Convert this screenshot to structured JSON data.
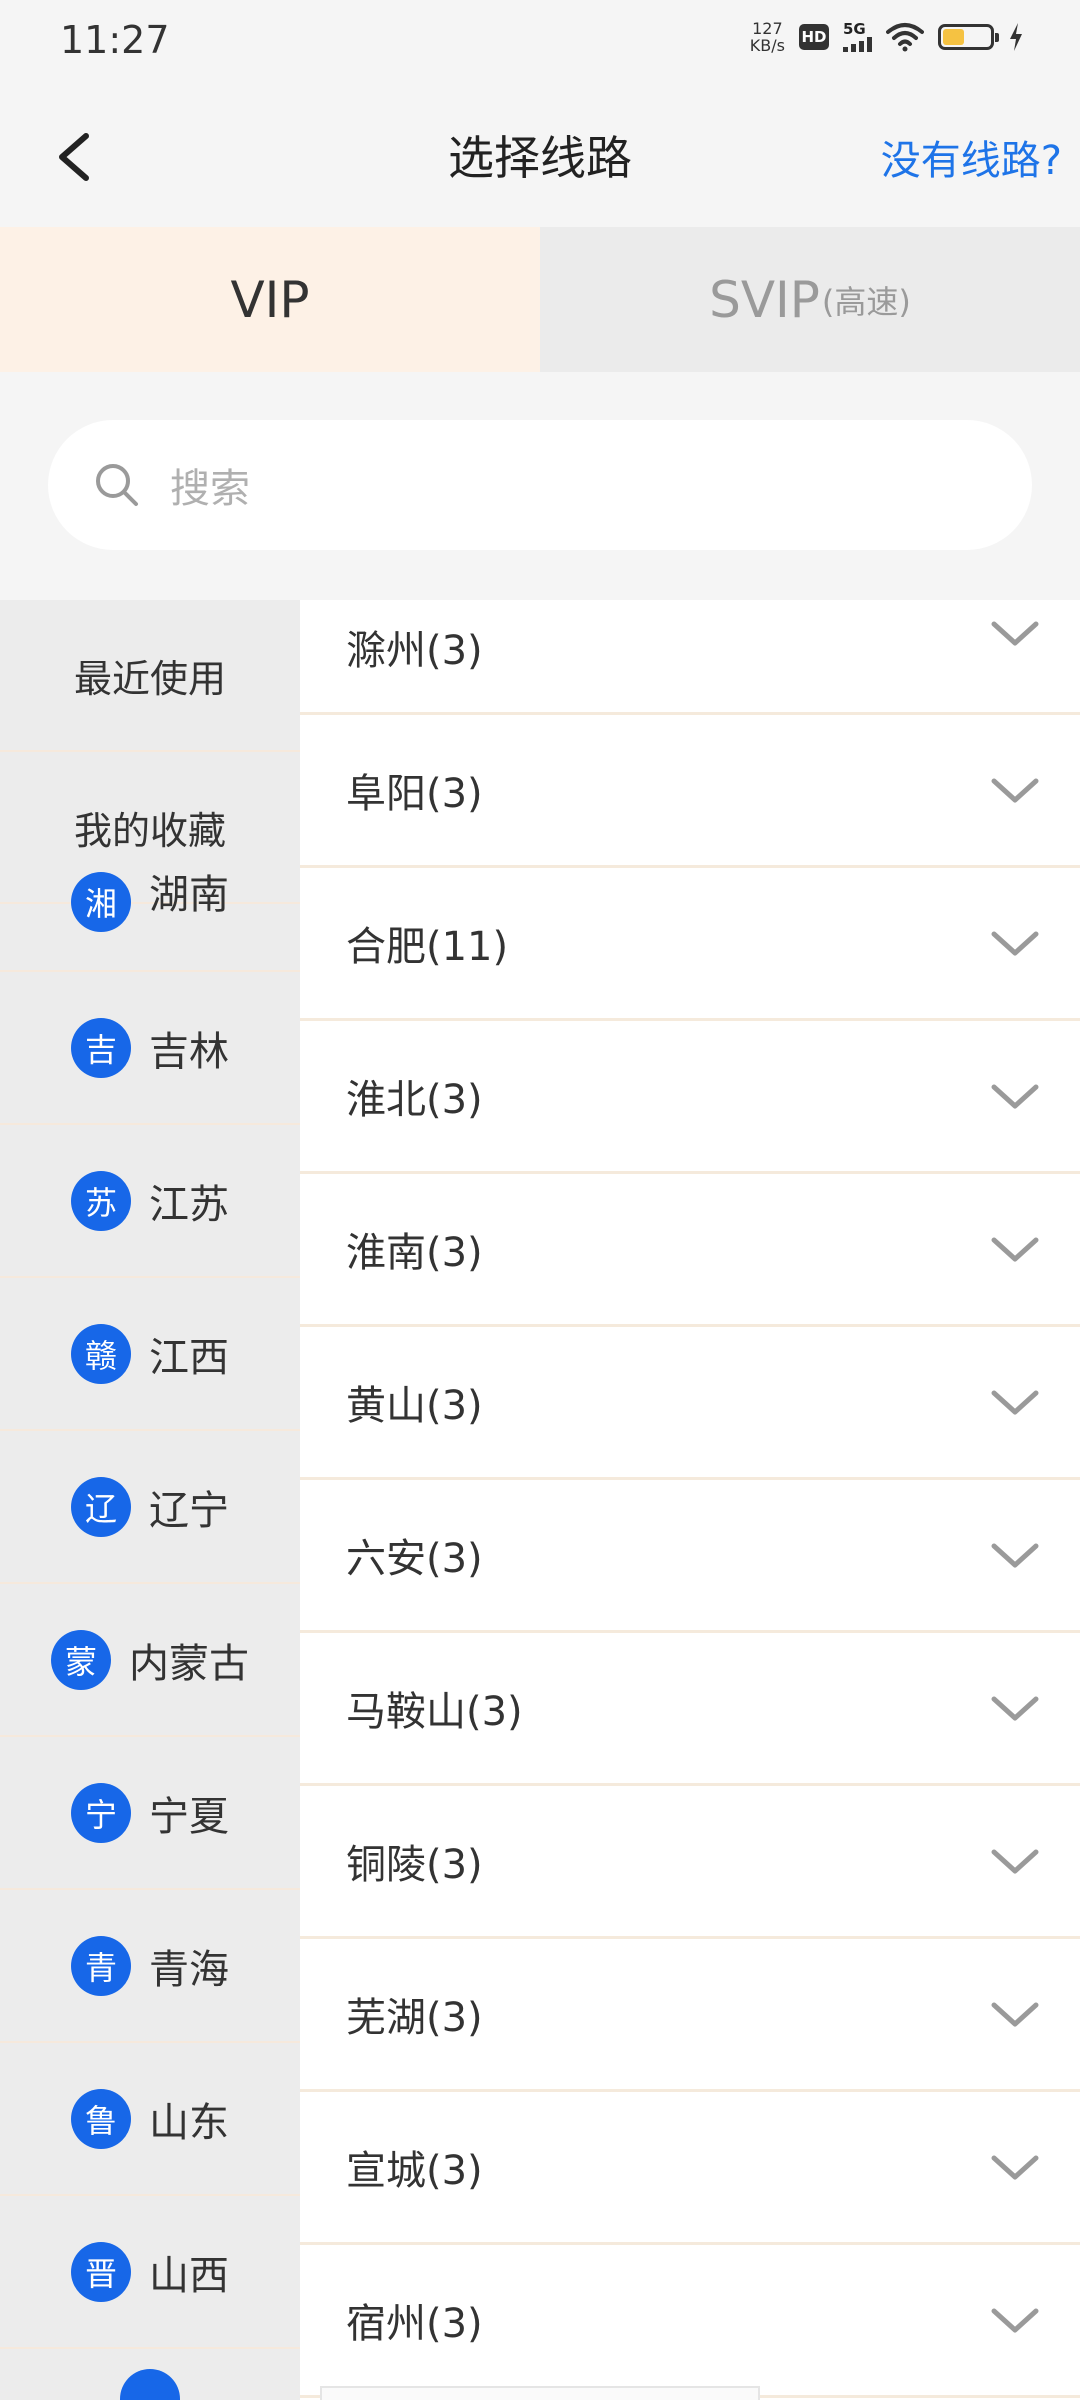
{
  "status_bar": {
    "time": "11:27",
    "net_speed_value": "127",
    "net_speed_unit": "KB/s",
    "hd_label": "HD",
    "network_label": "5G",
    "battery_level_percent": 45,
    "battery_color": "#f5c242"
  },
  "header": {
    "title": "选择线路",
    "no_route_link": "没有线路?",
    "accent_color": "#1e74e8"
  },
  "tabs": [
    {
      "label": "VIP",
      "sub": "",
      "selected": true
    },
    {
      "label": "SVIP",
      "sub": "(高速)",
      "selected": false
    }
  ],
  "search": {
    "placeholder": "搜索"
  },
  "sidebar": {
    "fixed": [
      "最近使用",
      "我的收藏"
    ],
    "provinces": [
      {
        "badge": "湘",
        "name": "湖南"
      },
      {
        "badge": "吉",
        "name": "吉林"
      },
      {
        "badge": "苏",
        "name": "江苏"
      },
      {
        "badge": "赣",
        "name": "江西"
      },
      {
        "badge": "辽",
        "name": "辽宁"
      },
      {
        "badge": "蒙",
        "name": "内蒙古"
      },
      {
        "badge": "宁",
        "name": "宁夏"
      },
      {
        "badge": "青",
        "name": "青海"
      },
      {
        "badge": "鲁",
        "name": "山东"
      },
      {
        "badge": "晋",
        "name": "山西"
      }
    ],
    "badge_color": "#1767e8"
  },
  "cities": [
    "滁州(3)",
    "阜阳(3)",
    "合肥(11)",
    "淮北(3)",
    "淮南(3)",
    "黄山(3)",
    "六安(3)",
    "马鞍山(3)",
    "铜陵(3)",
    "芜湖(3)",
    "宣城(3)",
    "宿州(3)"
  ]
}
